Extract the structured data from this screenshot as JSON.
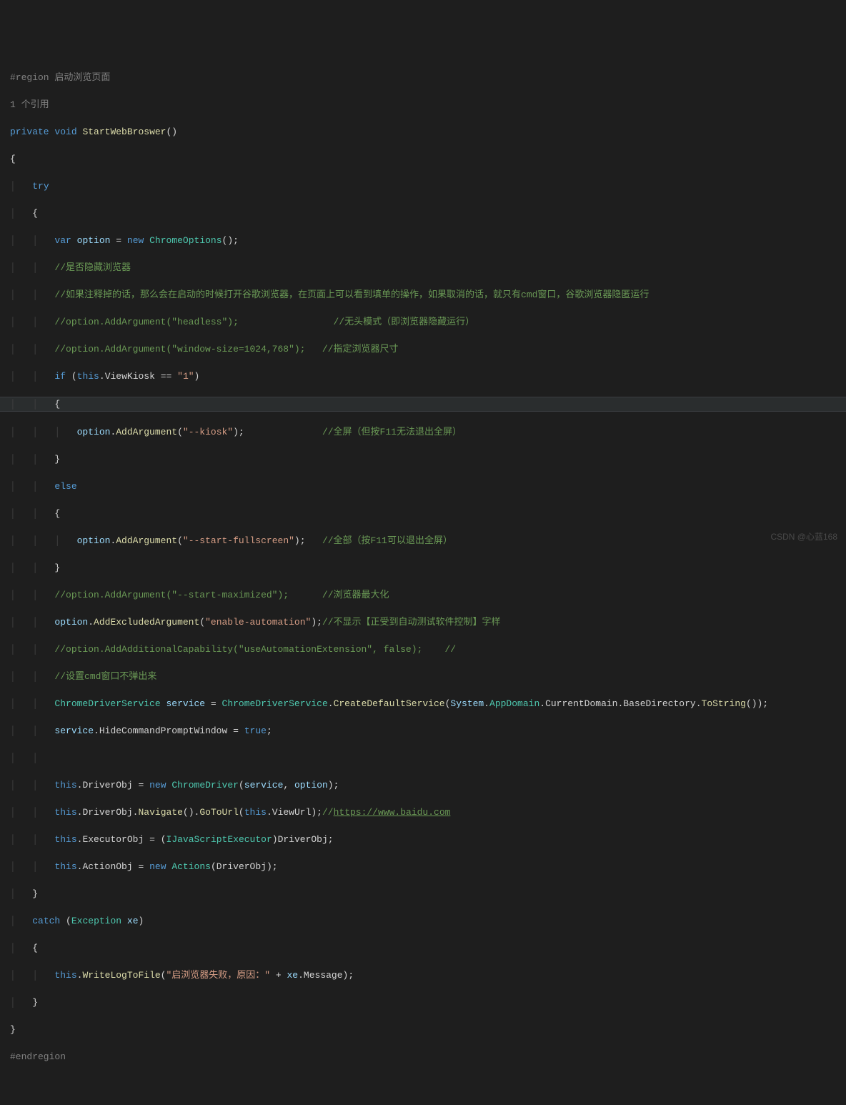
{
  "code": {
    "region_label": "#region 启动浏览页面",
    "references": "1 个引用",
    "method_sig": {
      "modifier": "private",
      "ret": "void",
      "name": "StartWebBroswer"
    },
    "tryKw": "try",
    "var_kw": "var",
    "option_var": "option",
    "new_kw": "new",
    "chrome_options": "ChromeOptions",
    "comment_hide_browser": "//是否隐藏浏览器",
    "comment_explain": "//如果注释掉的话，那么会在启动的时候打开谷歌浏览器，在页面上可以看到填单的操作，如果取消的话，就只有cmd窗口，谷歌浏览器隐匿运行",
    "comment_headless_code": "//option.AddArgument(\"headless\");",
    "comment_headless_txt": "//无头模式（即浏览器隐藏运行）",
    "comment_winsize_code": "//option.AddArgument(\"window-size=1024,768\");",
    "comment_winsize_txt": "//指定浏览器尺寸",
    "if_kw": "if",
    "this_kw": "this",
    "viewkiosk_prop": "ViewKiosk",
    "eq_lit": "\"1\"",
    "add_argument": "AddArgument",
    "kiosk_str": "\"--kiosk\"",
    "kiosk_comment": "//全屏（但按F11无法退出全屏）",
    "else_kw": "else",
    "fullscreen_str": "\"--start-fullscreen\"",
    "fullscreen_comment": "//全部（按F11可以退出全屏）",
    "comment_maximized_code": "//option.AddArgument(\"--start-maximized\");",
    "comment_maximized_txt": "//浏览器最大化",
    "add_excluded": "AddExcludedArgument",
    "enable_auto_str": "\"enable-automation\"",
    "enable_auto_comment": "//不显示【正受到自动测试软件控制】字样",
    "comment_capability": "//option.AddAdditionalCapability(\"useAutomationExtension\", false);    //",
    "comment_cmd": "//设置cmd窗口不弹出来",
    "cds_type": "ChromeDriverService",
    "service_var": "service",
    "create_default": "CreateDefaultService",
    "system_ns": "System",
    "appdomain": "AppDomain",
    "current_domain": "CurrentDomain",
    "base_directory": "BaseDirectory",
    "tostring": "ToString",
    "hide_prompt": "HideCommandPromptWindow",
    "true_kw": "true",
    "driver_obj": "DriverObj",
    "chrome_driver": "ChromeDriver",
    "navigate": "Navigate",
    "gotourl": "GoToUrl",
    "viewurl": "ViewUrl",
    "baidu_comment_prefix": "//",
    "baidu_url": "https://www.baidu.com",
    "executor_obj": "ExecutorObj",
    "ijs_executor": "IJavaScriptExecutor",
    "action_obj": "ActionObj",
    "actions_type": "Actions",
    "catch_kw": "catch",
    "exception_type": "Exception",
    "xe_var": "xe",
    "writelog": "WriteLogToFile",
    "log_msg": "\"启浏览器失败，原因：\"",
    "plus": " + ",
    "message_prop": "Message",
    "endregion": "#endregion"
  },
  "watermark": "CSDN @心蓝168"
}
